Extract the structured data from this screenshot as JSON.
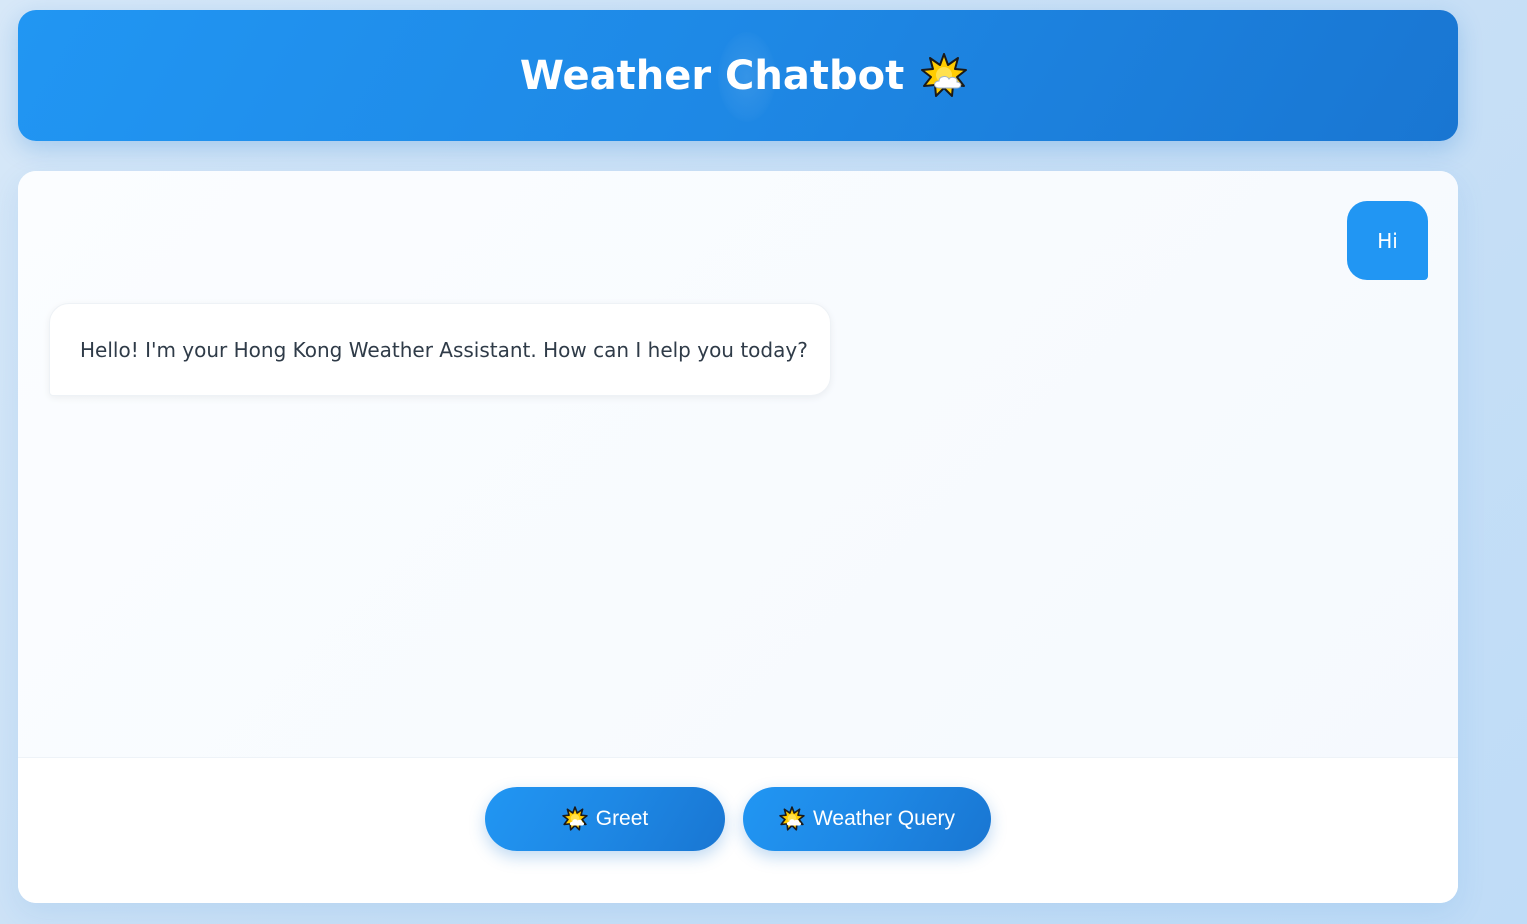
{
  "header": {
    "title": "Weather Chatbot",
    "title_icon": "sun-behind-cloud-icon"
  },
  "messages": [
    {
      "sender": "user",
      "text": "Hi"
    },
    {
      "sender": "bot",
      "text": "Hello! I'm your Hong Kong Weather Assistant. How can I help you today?"
    }
  ],
  "actions": {
    "greet_label": "Greet",
    "greet_icon": "sun-behind-cloud-icon",
    "weather_query_label": "Weather Query",
    "weather_query_icon": "sun-behind-cloud-icon"
  },
  "colors": {
    "accent": "#2196f3",
    "accent_dark": "#1976d2",
    "bot_text": "#2f3b48",
    "page_background": "#cfe4f7"
  }
}
